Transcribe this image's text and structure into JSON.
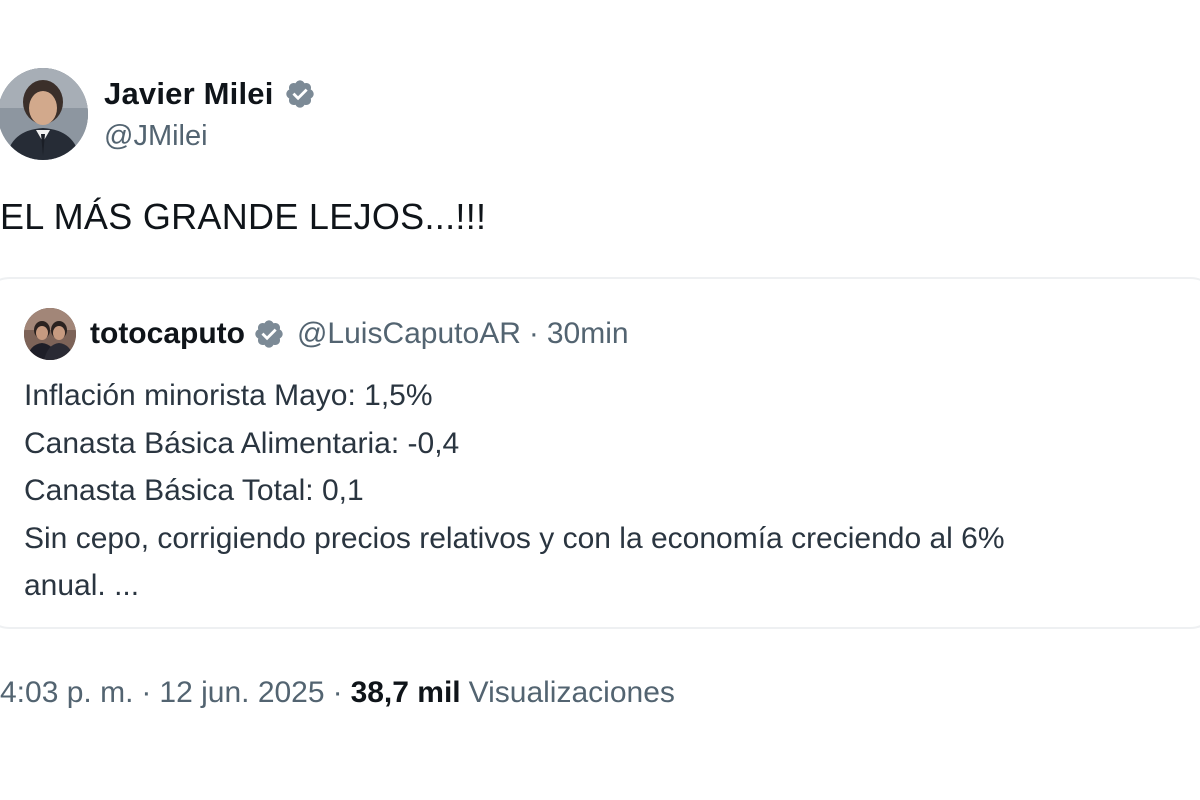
{
  "author": {
    "display_name": "Javier Milei",
    "handle": "@JMilei",
    "verified": true,
    "avatar_icon": "profile-photo"
  },
  "tweet": {
    "text": "EL MÁS GRANDE LEJOS...!!!"
  },
  "quoted_tweet": {
    "display_name": "totocaputo",
    "handle": "@LuisCaputoAR",
    "separator": "·",
    "time": "30min",
    "verified": true,
    "lines": [
      "Inflación minorista Mayo: 1,5%",
      "Canasta Básica Alimentaria: -0,4",
      "Canasta Básica Total: 0,1",
      "Sin cepo, corrigiendo precios relativos y con la economía creciendo al 6%",
      "anual. ..."
    ]
  },
  "meta": {
    "time": "4:03 p. m.",
    "separator": "·",
    "date": "12 jun. 2025",
    "views_count": "38,7 mil",
    "views_label": "Visualizaciones"
  },
  "colors": {
    "verified_badge": "#7c8a96",
    "secondary_text": "#536471",
    "primary_text": "#0f1419",
    "card_border": "#eef0f2"
  }
}
